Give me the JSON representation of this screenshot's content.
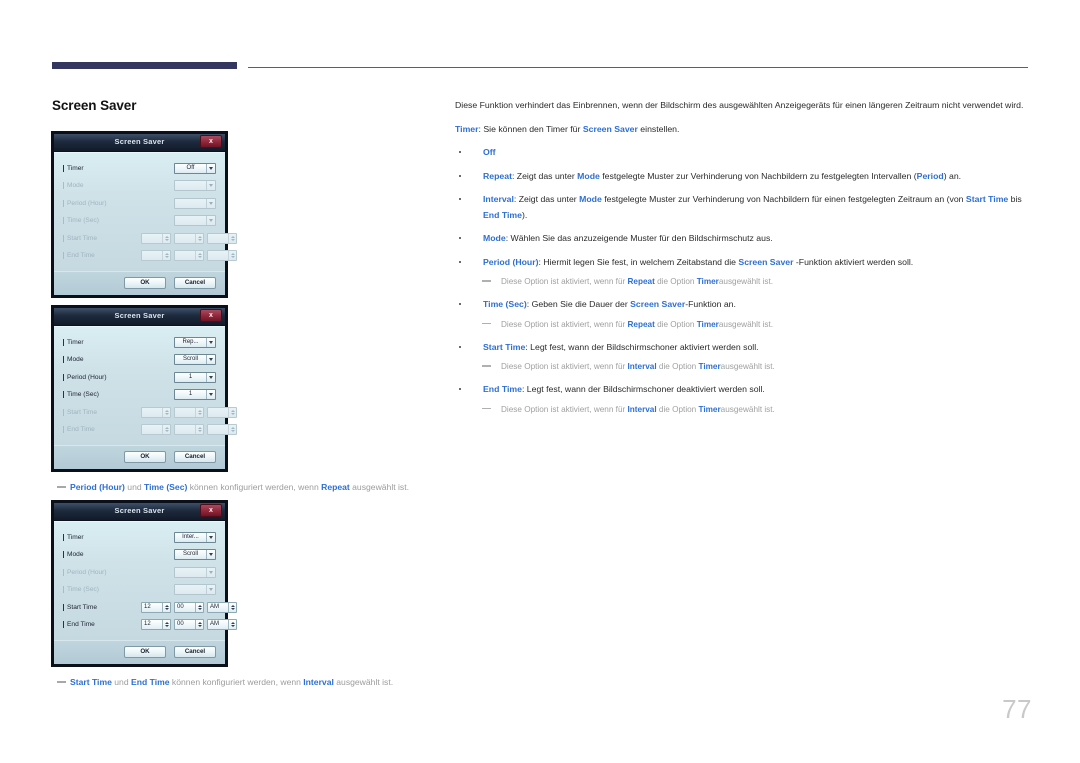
{
  "page": {
    "heading": "Screen Saver",
    "number": "77",
    "accent_color": "#2e6fd4",
    "rule_color": "#33365e"
  },
  "dialogs": [
    {
      "title": "Screen Saver",
      "close_label": "x",
      "rows": [
        {
          "label": "Timer",
          "control": "combo",
          "value": "Off",
          "enabled": true
        },
        {
          "label": "Mode",
          "control": "combo",
          "value": "",
          "enabled": false
        },
        {
          "label": "Period (Hour)",
          "control": "combo",
          "value": "",
          "enabled": false
        },
        {
          "label": "Time (Sec)",
          "control": "combo",
          "value": "",
          "enabled": false
        },
        {
          "label": "Start Time",
          "control": "time",
          "values": [
            "",
            "",
            ""
          ],
          "enabled": false
        },
        {
          "label": "End Time",
          "control": "time",
          "values": [
            "",
            "",
            ""
          ],
          "enabled": false
        }
      ],
      "ok_label": "OK",
      "cancel_label": "Cancel"
    },
    {
      "title": "Screen Saver",
      "close_label": "x",
      "rows": [
        {
          "label": "Timer",
          "control": "combo",
          "value": "Rep...",
          "enabled": true
        },
        {
          "label": "Mode",
          "control": "combo",
          "value": "Scroll",
          "enabled": true
        },
        {
          "label": "Period (Hour)",
          "control": "combo",
          "value": "1",
          "enabled": true
        },
        {
          "label": "Time (Sec)",
          "control": "combo",
          "value": "1",
          "enabled": true
        },
        {
          "label": "Start Time",
          "control": "time",
          "values": [
            "",
            "",
            ""
          ],
          "enabled": false
        },
        {
          "label": "End Time",
          "control": "time",
          "values": [
            "",
            "",
            ""
          ],
          "enabled": false
        }
      ],
      "ok_label": "OK",
      "cancel_label": "Cancel"
    },
    {
      "title": "Screen Saver",
      "close_label": "x",
      "rows": [
        {
          "label": "Timer",
          "control": "combo",
          "value": "Inter...",
          "enabled": true
        },
        {
          "label": "Mode",
          "control": "combo",
          "value": "Scroll",
          "enabled": true
        },
        {
          "label": "Period (Hour)",
          "control": "combo",
          "value": "",
          "enabled": false
        },
        {
          "label": "Time (Sec)",
          "control": "combo",
          "value": "",
          "enabled": false
        },
        {
          "label": "Start Time",
          "control": "time",
          "values": [
            "12",
            "00",
            "AM"
          ],
          "enabled": true
        },
        {
          "label": "End Time",
          "control": "time",
          "values": [
            "12",
            "00",
            "AM"
          ],
          "enabled": true
        }
      ],
      "ok_label": "OK",
      "cancel_label": "Cancel"
    }
  ],
  "left_notes": [
    {
      "html": "<b>Period (Hour)</b> und <b>Time (Sec)</b> können konfiguriert werden, wenn <b>Repeat</b> ausgewählt ist."
    },
    {
      "html": "<b>Start Time</b> und <b>End Time</b> können konfiguriert werden, wenn <b>Interval</b> ausgewählt ist."
    }
  ],
  "right": {
    "intro": "Diese Funktion verhindert das Einbrennen, wenn der Bildschirm des ausgewählten Anzeigegeräts für einen längeren Zeitraum nicht verwendet wird.",
    "lead_html": "<b>Timer</b>: Sie können den Timer für <b>Screen Saver</b> einstellen.",
    "items": [
      {
        "type": "bullet",
        "html": "<b>Off</b>"
      },
      {
        "type": "bullet",
        "html": "<b>Repeat</b>: Zeigt das unter <b>Mode</b> festgelegte Muster zur Verhinderung von Nachbildern zu festgelegten Intervallen (<b>Period</b>) an."
      },
      {
        "type": "bullet",
        "html": "<b>Interval</b>: Zeigt das unter <b>Mode</b> festgelegte Muster zur Verhinderung von Nachbildern für einen festgelegten Zeitraum an (von <b>Start Time</b> bis <b>End Time</b>)."
      },
      {
        "type": "bullet",
        "html": "<b>Mode</b>: Wählen Sie das anzuzeigende Muster für den Bildschirmschutz aus."
      },
      {
        "type": "bullet",
        "html": "<b>Period (Hour)</b>: Hiermit legen Sie fest, in welchem Zeitabstand die <b>Screen Saver</b> -Funktion aktiviert werden soll."
      },
      {
        "type": "sub",
        "html": "Diese Option ist aktiviert, wenn für <b>Repeat</b> die Option <b>Timer</b>ausgewählt ist."
      },
      {
        "type": "bullet",
        "html": "<b>Time (Sec)</b>: Geben Sie die Dauer der <b>Screen Saver</b>-Funktion an."
      },
      {
        "type": "sub",
        "html": "Diese Option ist aktiviert, wenn für <b>Repeat</b> die Option <b>Timer</b>ausgewählt ist."
      },
      {
        "type": "bullet",
        "html": "<b>Start Time</b>: Legt fest, wann der Bildschirmschoner aktiviert werden soll."
      },
      {
        "type": "sub",
        "html": "Diese Option ist aktiviert, wenn für <b>Interval</b> die Option <b>Timer</b>ausgewählt ist."
      },
      {
        "type": "bullet",
        "html": "<b>End Time</b>: Legt fest, wann der Bildschirmschoner deaktiviert werden soll."
      },
      {
        "type": "sub",
        "html": "Diese Option ist aktiviert, wenn für <b>Interval</b> die Option <b>Timer</b>ausgewählt ist."
      }
    ]
  }
}
